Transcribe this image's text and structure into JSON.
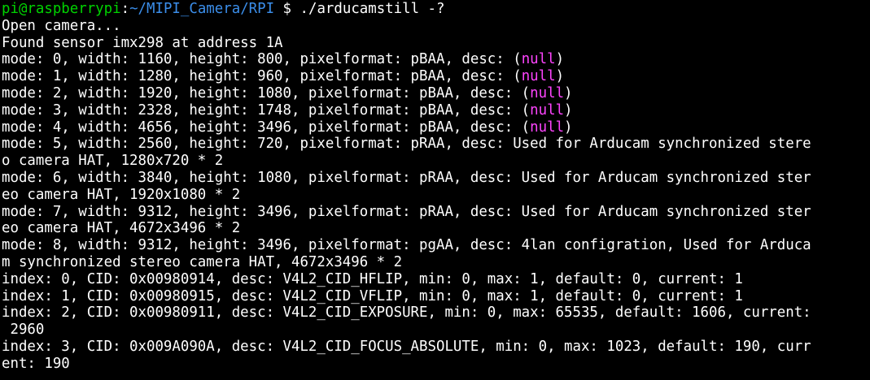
{
  "colors": {
    "background": "#000000",
    "foreground": "#ffffff",
    "prompt_user": "#00d300",
    "prompt_path": "#3b8eea",
    "null_highlight": "#ff44ff"
  },
  "prompt": {
    "user_host": "pi@raspberrypi",
    "colon": ":",
    "path": "~/MIPI_Camera/RPI",
    "symbol": " $ ",
    "command": "./arducamstill -?"
  },
  "output": {
    "open_camera": "Open camera...",
    "found_sensor": "Found sensor imx298 at address 1A",
    "mode_lines": [
      {
        "text": "mode: 0, width: 1160, height: 800, pixelformat: pBAA, desc: (",
        "null": "null",
        "tail": ")"
      },
      {
        "text": "mode: 1, width: 1280, height: 960, pixelformat: pBAA, desc: (",
        "null": "null",
        "tail": ")"
      },
      {
        "text": "mode: 2, width: 1920, height: 1080, pixelformat: pBAA, desc: (",
        "null": "null",
        "tail": ")"
      },
      {
        "text": "mode: 3, width: 2328, height: 1748, pixelformat: pBAA, desc: (",
        "null": "null",
        "tail": ")"
      },
      {
        "text": "mode: 4, width: 4656, height: 3496, pixelformat: pBAA, desc: (",
        "null": "null",
        "tail": ")"
      }
    ],
    "wrapped_lines": [
      "mode: 5, width: 2560, height: 720, pixelformat: pRAA, desc: Used for Arducam synchronized stere",
      "o camera HAT, 1280x720 * 2",
      "mode: 6, width: 3840, height: 1080, pixelformat: pRAA, desc: Used for Arducam synchronized ster",
      "eo camera HAT, 1920x1080 * 2",
      "mode: 7, width: 9312, height: 3496, pixelformat: pRAA, desc: Used for Arducam synchronized ster",
      "eo camera HAT, 4672x3496 * 2",
      "mode: 8, width: 9312, height: 3496, pixelformat: pgAA, desc: 4lan configration, Used for Arduca",
      "m synchronized stereo camera HAT, 4672x3496 * 2",
      "index: 0, CID: 0x00980914, desc: V4L2_CID_HFLIP, min: 0, max: 1, default: 0, current: 1",
      "index: 1, CID: 0x00980915, desc: V4L2_CID_VFLIP, min: 0, max: 1, default: 0, current: 1",
      "index: 2, CID: 0x00980911, desc: V4L2_CID_EXPOSURE, min: 0, max: 65535, default: 1606, current:",
      " 2960",
      "index: 3, CID: 0x009A090A, desc: V4L2_CID_FOCUS_ABSOLUTE, min: 0, max: 1023, default: 190, curr",
      "ent: 190"
    ]
  }
}
